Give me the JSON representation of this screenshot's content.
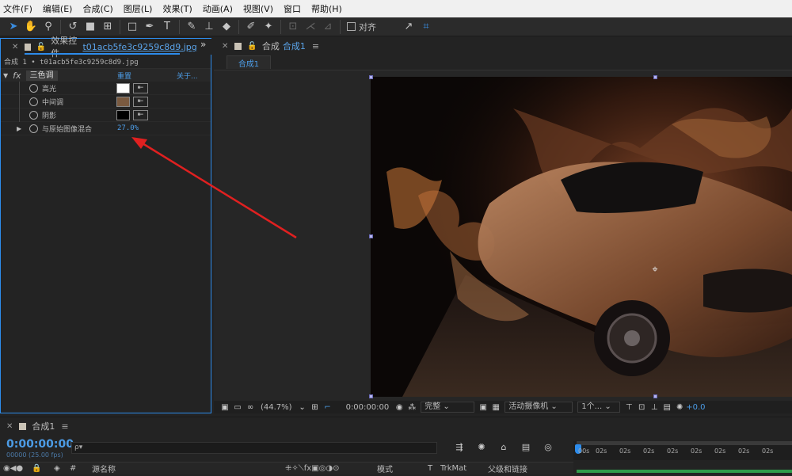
{
  "menubar": {
    "items": [
      "文件(F)",
      "编辑(E)",
      "合成(C)",
      "图层(L)",
      "效果(T)",
      "动画(A)",
      "视图(V)",
      "窗口",
      "帮助(H)"
    ]
  },
  "toolbar": {
    "snap_label": "对齐",
    "tools": [
      "selection-arrow",
      "hand",
      "zoom",
      "rotate",
      "camera",
      "pan-behind",
      "rectangle",
      "pen",
      "type",
      "brush",
      "clone-stamp",
      "eraser",
      "roto-brush",
      "puppet-pin"
    ]
  },
  "effect_controls": {
    "tab_label": "效果控件",
    "file_name": "t01acb5fe3c9259c8d9.jpg",
    "breadcrumb": "合成 1 • t01acb5fe3c9259c8d9.jpg",
    "effect": {
      "fx_label": "fx",
      "name": "三色调",
      "reset_label": "重置",
      "about_label": "关于..."
    },
    "properties": [
      {
        "label": "高光",
        "color": "#ffffff"
      },
      {
        "label": "中间调",
        "color": "#7a5a40"
      },
      {
        "label": "阴影",
        "color": "#000000"
      }
    ],
    "blend": {
      "label": "与原始图像混合",
      "value": "27.0%"
    }
  },
  "composition": {
    "tab_prefix": "合成",
    "tab_name": "合成1",
    "subtab": "合成1",
    "viewbar": {
      "zoom": "(44.7%)",
      "timecode": "0:00:00:00",
      "resolution": "完整",
      "camera": "活动摄像机",
      "views": "1个...",
      "exposure": "+0.0"
    }
  },
  "timeline": {
    "tab": "合成1",
    "timecode": "0:00:00:00",
    "frames": "00000 (25.00 fps)",
    "search_placeholder": "ρ▾",
    "columns": {
      "source_name": "源名称",
      "mode": "模式",
      "t": "T",
      "trkmat": "TrkMat",
      "parent": "父级和链接"
    },
    "ruler_ticks": [
      "00s",
      "02s",
      "02s",
      "02s",
      "02s",
      "02s",
      "02s",
      "02s",
      "02s"
    ]
  },
  "colors": {
    "accent": "#2d8ceb",
    "annotation_arrow": "#e02020"
  }
}
